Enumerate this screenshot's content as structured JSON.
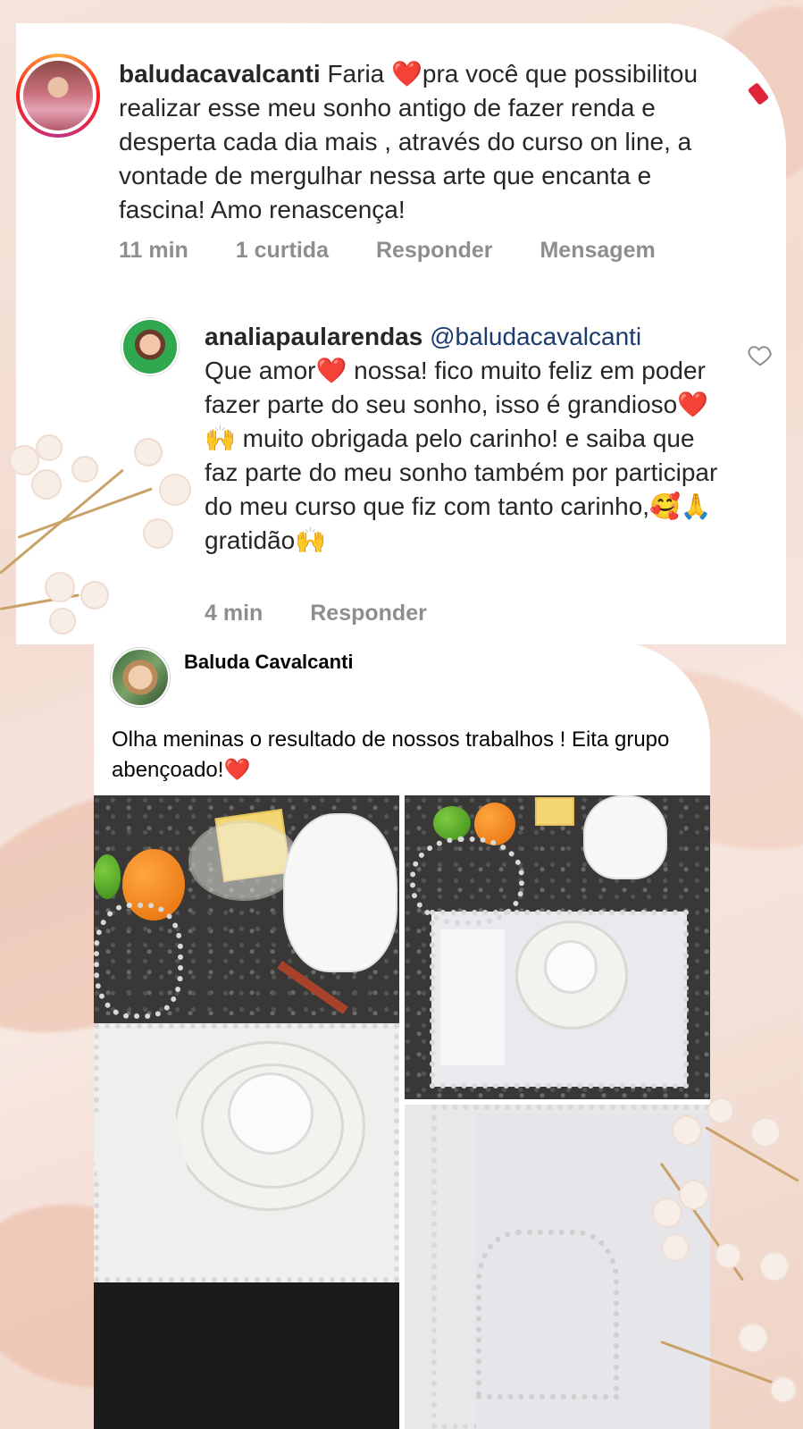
{
  "instagram": {
    "comment": {
      "username": "baludacavalcanti",
      "text": "Faria ❤️pra você que possibilitou realizar esse meu sonho antigo de fazer renda e desperta cada dia mais , através do curso on line, a vontade de mergulhar nessa arte que encanta e fascina! Amo renascença!",
      "time": "11 min",
      "likes": "1 curtida",
      "reply_label": "Responder",
      "message_label": "Mensagem"
    },
    "reply": {
      "username": "analiapaularendas",
      "mention": "@baludacavalcanti",
      "text": "Que amor❤️ nossa! fico muito feliz em poder fazer parte do seu sonho, isso é grandioso❤️🙌 muito obrigada pelo carinho! e saiba que faz parte do meu sonho também por participar do meu curso que fiz com tanto carinho,🥰🙏 gratidão🙌",
      "time": "4 min",
      "reply_label": "Responder"
    }
  },
  "facebook_post": {
    "author": "Baluda Cavalcanti",
    "text": "Olha meninas o resultado de nossos trabalhos ! Eita grupo abençoado!❤️",
    "photo_count": 3
  },
  "colors": {
    "background": "#f3dcd1",
    "card": "#ffffff",
    "meta_gray": "#8e8e8e",
    "mention": "#1b3b6f",
    "branch": "#c9a268"
  },
  "icons": [
    "heart-outline-icon",
    "flag-icon"
  ]
}
